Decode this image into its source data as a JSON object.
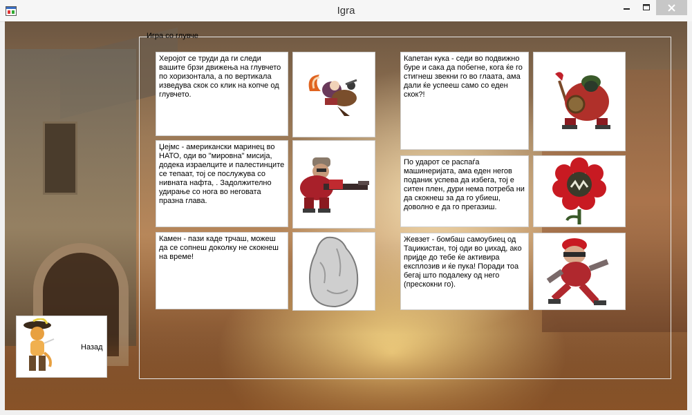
{
  "window": {
    "title": "Igra"
  },
  "group": {
    "legend": "Игра со глувче"
  },
  "left_column": [
    {
      "text": "Херојот се труди да ги следи вашите брзи движења на глувчето по хоризонтала, а по вертикала изведува скок со клик на копче од глувчето.",
      "image": "hero-character-icon"
    },
    {
      "text": "Џејмс - американски маринец во НАТО, оди во \"мировна\" мисија, додека израелците и палестинците се тепаат, тој се послужува со нивната нафта, . Задолжително удирање со нога во неговата празна глава.",
      "image": "marine-soldier-icon"
    },
    {
      "text": "Камен - пази каде трчаш, можеш да се сопнеш доколку не скокнеш на време!",
      "image": "stone-icon"
    }
  ],
  "right_column": [
    {
      "text": "Капетан кука - седи во подвижно буре и сака да побегне, кога ќе го стигнеш звекни го во глаата, ама дали ќе успееш само со еден скок?!",
      "image": "captain-barrel-icon"
    },
    {
      "text": "По ударот се распаѓа машинеријата, ама еден негов поданик успева да избега, тој е ситен плен, дури нема потреба ни да скокнеш за да го убиеш, доволно е да го прегазиш.",
      "image": "flower-monster-icon"
    },
    {
      "text": "Жевзет - бомбаш самоубиец од Таџикистан, тој оди во џихад, ако пријде до тебе ќе активира експлозив и ќе пука! Поради тоа бегај што подалеку од него (прескокни го).",
      "image": "bomber-runner-icon"
    }
  ],
  "back": {
    "label": "Назад",
    "image": "puss-in-boots-icon"
  }
}
